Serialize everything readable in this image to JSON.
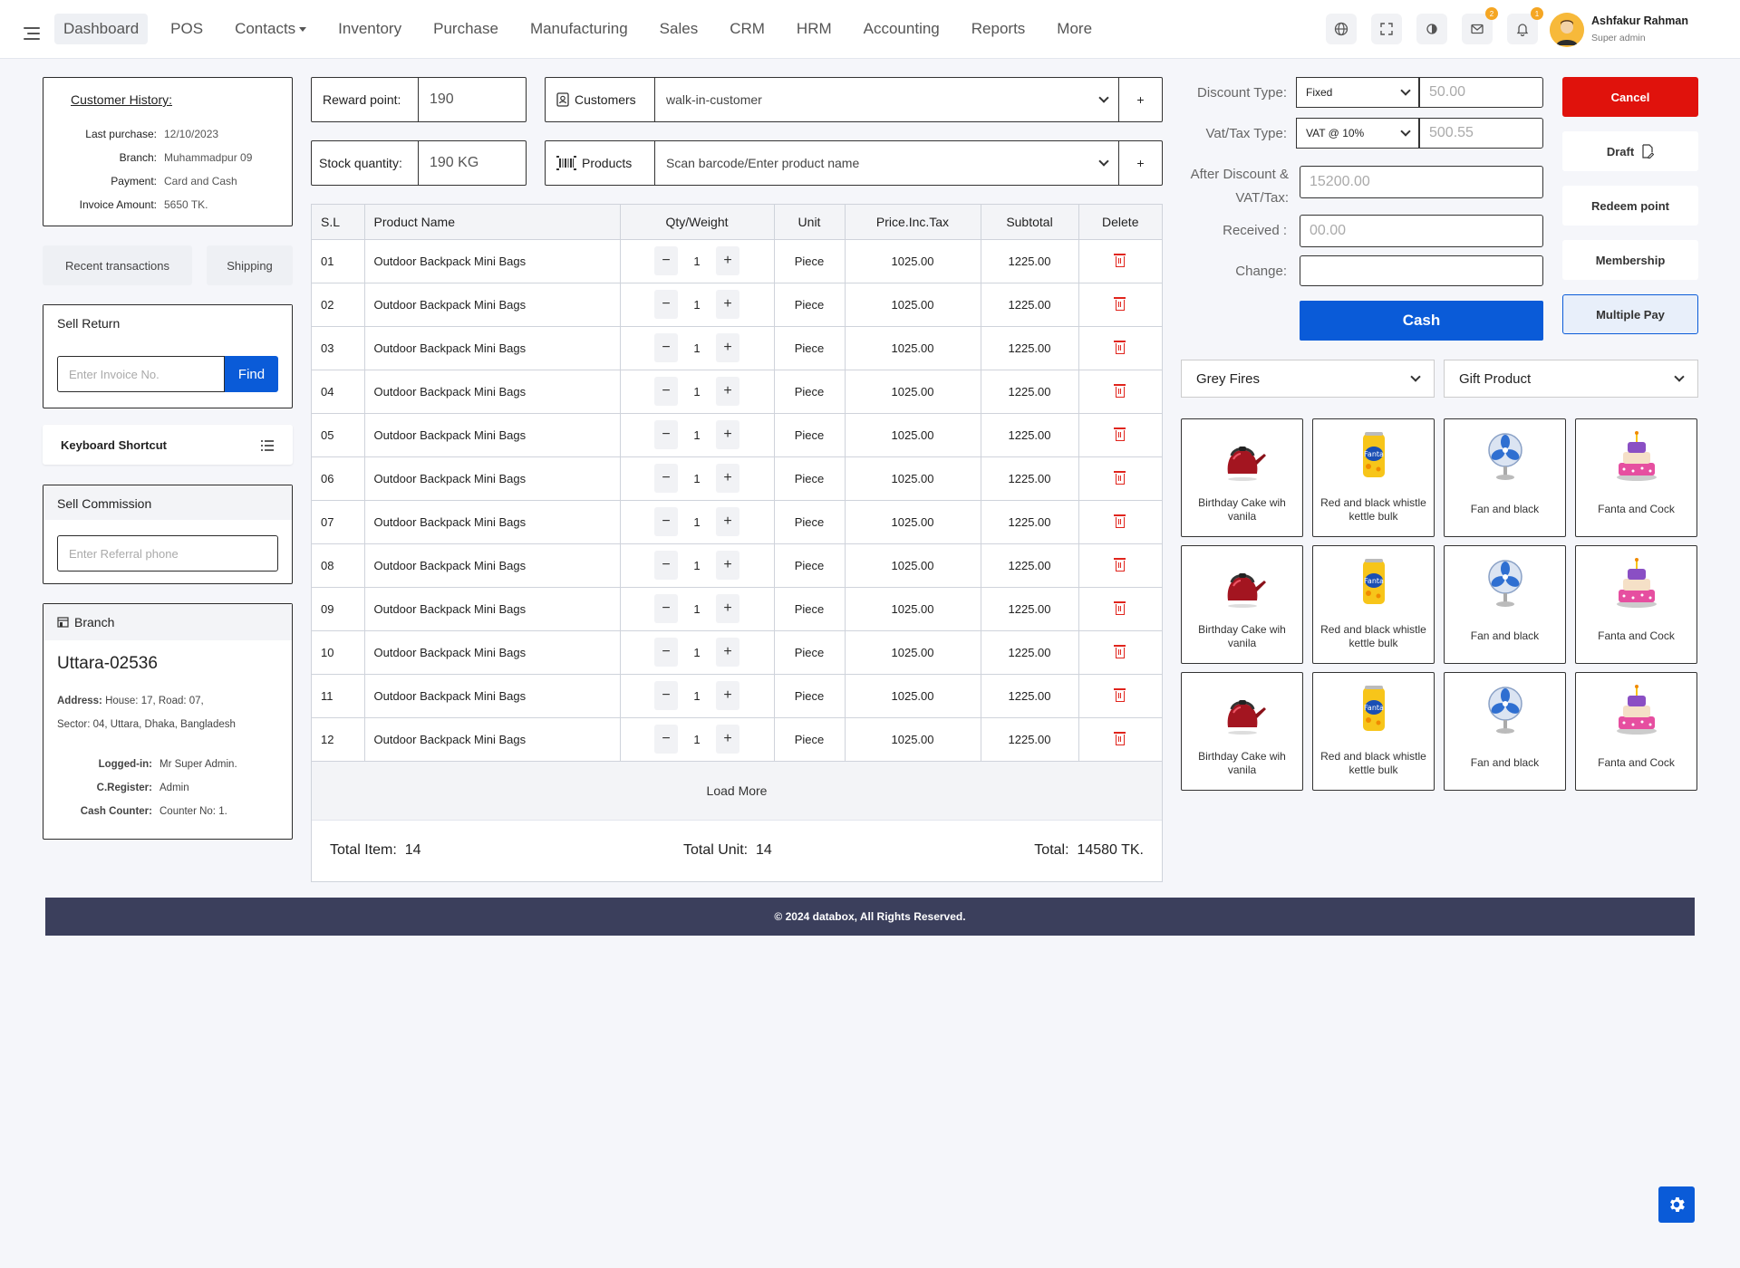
{
  "nav": {
    "items": [
      {
        "label": "Dashboard",
        "active": true,
        "caret": false
      },
      {
        "label": "POS",
        "active": false,
        "caret": false
      },
      {
        "label": "Contacts",
        "active": false,
        "caret": true
      },
      {
        "label": "Inventory",
        "active": false,
        "caret": false
      },
      {
        "label": "Purchase",
        "active": false,
        "caret": false
      },
      {
        "label": "Manufacturing",
        "active": false,
        "caret": false
      },
      {
        "label": "Sales",
        "active": false,
        "caret": false
      },
      {
        "label": "CRM",
        "active": false,
        "caret": false
      },
      {
        "label": "HRM",
        "active": false,
        "caret": false
      },
      {
        "label": "Accounting",
        "active": false,
        "caret": false
      },
      {
        "label": "Reports",
        "active": false,
        "caret": false
      },
      {
        "label": "More",
        "active": false,
        "caret": false
      }
    ],
    "mail_badge": "2",
    "bell_badge": "1",
    "user_name": "Ashfakur Rahman",
    "user_role": "Super admin"
  },
  "customer_history": {
    "title": "Customer History:",
    "rows": [
      {
        "k": "Last purchase:",
        "v": "12/10/2023"
      },
      {
        "k": "Branch:",
        "v": "Muhammadpur 09"
      },
      {
        "k": "Payment:",
        "v": "Card and Cash"
      },
      {
        "k": "Invoice Amount:",
        "v": "5650 TK."
      }
    ]
  },
  "left_buttons": {
    "recent": "Recent transactions",
    "shipping": "Shipping"
  },
  "sell_return": {
    "title": "Sell Return",
    "placeholder": "Enter Invoice No.",
    "find": "Find"
  },
  "shortcut": {
    "label": "Keyboard Shortcut"
  },
  "commission": {
    "title": "Sell Commission",
    "placeholder": "Enter Referral phone"
  },
  "branch": {
    "title": "Branch",
    "name": "Uttara-02536",
    "address_label": "Address:",
    "address1": "House: 17, Road: 07,",
    "address2": "Sector: 04, Uttara, Dhaka, Bangladesh",
    "rows": [
      {
        "k": "Logged-in:",
        "v": "Mr Super Admin."
      },
      {
        "k": "C.Register:",
        "v": "Admin"
      },
      {
        "k": "Cash Counter:",
        "v": "Counter No: 1."
      }
    ]
  },
  "reward": {
    "label": "Reward point:",
    "value": "190"
  },
  "stock": {
    "label": "Stock quantity:",
    "value": "190 KG"
  },
  "customers": {
    "label": "Customers",
    "value": "walk-in-customer",
    "add": "+"
  },
  "products": {
    "label": "Products",
    "placeholder": "Scan barcode/Enter product name",
    "add": "+"
  },
  "table": {
    "headers": [
      "S.L",
      "Product Name",
      "Qty/Weight",
      "Unit",
      "Price.Inc.Tax",
      "Subtotal",
      "Delete"
    ],
    "rows": [
      {
        "sl": "01",
        "name": "Outdoor Backpack Mini Bags",
        "qty": "1",
        "unit": "Piece",
        "price": "1025.00",
        "subtotal": "1225.00"
      },
      {
        "sl": "02",
        "name": "Outdoor Backpack Mini Bags",
        "qty": "1",
        "unit": "Piece",
        "price": "1025.00",
        "subtotal": "1225.00"
      },
      {
        "sl": "03",
        "name": "Outdoor Backpack Mini Bags",
        "qty": "1",
        "unit": "Piece",
        "price": "1025.00",
        "subtotal": "1225.00"
      },
      {
        "sl": "04",
        "name": "Outdoor Backpack Mini Bags",
        "qty": "1",
        "unit": "Piece",
        "price": "1025.00",
        "subtotal": "1225.00"
      },
      {
        "sl": "05",
        "name": "Outdoor Backpack Mini Bags",
        "qty": "1",
        "unit": "Piece",
        "price": "1025.00",
        "subtotal": "1225.00"
      },
      {
        "sl": "06",
        "name": "Outdoor Backpack Mini Bags",
        "qty": "1",
        "unit": "Piece",
        "price": "1025.00",
        "subtotal": "1225.00"
      },
      {
        "sl": "07",
        "name": "Outdoor Backpack Mini Bags",
        "qty": "1",
        "unit": "Piece",
        "price": "1025.00",
        "subtotal": "1225.00"
      },
      {
        "sl": "08",
        "name": "Outdoor Backpack Mini Bags",
        "qty": "1",
        "unit": "Piece",
        "price": "1025.00",
        "subtotal": "1225.00"
      },
      {
        "sl": "09",
        "name": "Outdoor Backpack Mini Bags",
        "qty": "1",
        "unit": "Piece",
        "price": "1025.00",
        "subtotal": "1225.00"
      },
      {
        "sl": "10",
        "name": "Outdoor Backpack Mini Bags",
        "qty": "1",
        "unit": "Piece",
        "price": "1025.00",
        "subtotal": "1225.00"
      },
      {
        "sl": "11",
        "name": "Outdoor Backpack Mini Bags",
        "qty": "1",
        "unit": "Piece",
        "price": "1025.00",
        "subtotal": "1225.00"
      },
      {
        "sl": "12",
        "name": "Outdoor Backpack Mini Bags",
        "qty": "1",
        "unit": "Piece",
        "price": "1025.00",
        "subtotal": "1225.00"
      }
    ],
    "load_more": "Load More",
    "total_item_label": "Total Item:",
    "total_item": "14",
    "total_unit_label": "Total Unit:",
    "total_unit": "14",
    "total_label": "Total:",
    "total": "14580 TK."
  },
  "payment": {
    "discount_type_label": "Discount Type:",
    "discount_type": "Fixed",
    "discount_value": "50.00",
    "vat_label": "Vat/Tax Type:",
    "vat_type": "VAT @ 10%",
    "vat_value": "500.55",
    "after_label1": "After Discount &",
    "after_label2": "VAT/Tax:",
    "after_value": "15200.00",
    "received_label": "Received :",
    "received_value": "00.00",
    "change_label": "Change:",
    "change_value": "",
    "cash": "Cash"
  },
  "actions": {
    "cancel": "Cancel",
    "draft": "Draft",
    "redeem": "Redeem point",
    "membership": "Membership",
    "multiple": "Multiple Pay"
  },
  "filters": {
    "category": "Grey Fires",
    "type": "Gift Product"
  },
  "products_grid": [
    {
      "name": "Birthday Cake wih vanila",
      "icon": "kettle-icon"
    },
    {
      "name": "Red and black whistle kettle bulk",
      "icon": "soda-can-icon"
    },
    {
      "name": "Fan and black",
      "icon": "fan-icon"
    },
    {
      "name": "Fanta and Cock",
      "icon": "cake-icon"
    },
    {
      "name": "Birthday Cake wih vanila",
      "icon": "kettle-icon"
    },
    {
      "name": "Red and black whistle kettle bulk",
      "icon": "soda-can-icon"
    },
    {
      "name": "Fan and black",
      "icon": "fan-icon"
    },
    {
      "name": "Fanta and Cock",
      "icon": "cake-icon"
    },
    {
      "name": "Birthday Cake wih vanila",
      "icon": "kettle-icon"
    },
    {
      "name": "Red and black whistle kettle bulk",
      "icon": "soda-can-icon"
    },
    {
      "name": "Fan and black",
      "icon": "fan-icon"
    },
    {
      "name": "Fanta and Cock",
      "icon": "cake-icon"
    }
  ],
  "footer": "© 2024 databox, All Rights Reserved.",
  "colors": {
    "primary": "#0a5bd8",
    "danger": "#e0120c",
    "footer": "#3b3f5c"
  }
}
